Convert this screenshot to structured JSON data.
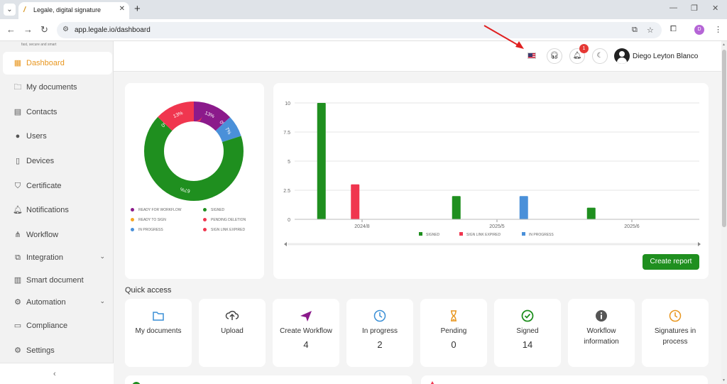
{
  "browser": {
    "tab_title": "Legale, digital signature",
    "url": "app.legale.io/dashboard",
    "profile_initial": "D"
  },
  "sidebar": {
    "logo_tagline": "fast, secure and smart",
    "items": [
      {
        "label": "Dashboard",
        "icon": "grid-icon",
        "active": true
      },
      {
        "label": "My documents",
        "icon": "folder-icon"
      },
      {
        "label": "Contacts",
        "icon": "contacts-icon"
      },
      {
        "label": "Users",
        "icon": "user-icon"
      },
      {
        "label": "Devices",
        "icon": "device-icon"
      },
      {
        "label": "Certificate",
        "icon": "shield-icon"
      },
      {
        "label": "Notifications",
        "icon": "bell-icon"
      },
      {
        "label": "Workflow",
        "icon": "workflow-icon"
      },
      {
        "label": "Integration",
        "icon": "integration-icon",
        "expandable": true
      },
      {
        "label": "Smart document",
        "icon": "smart-document-icon"
      },
      {
        "label": "Automation",
        "icon": "automation-icon",
        "expandable": true
      },
      {
        "label": "Compliance",
        "icon": "compliance-icon"
      },
      {
        "label": "Settings",
        "icon": "gear-icon"
      }
    ]
  },
  "header": {
    "notification_count": "1",
    "user_name": "Diego Leyton Blanco"
  },
  "donut": {
    "legend": [
      {
        "label": "READY FOR WORKFLOW",
        "color": "#8b1a8b"
      },
      {
        "label": "SIGNED",
        "color": "#1f8f1f"
      },
      {
        "label": "READY TO SIGN",
        "color": "#f5a623"
      },
      {
        "label": "PENDING DELETION",
        "color": "#f0364f"
      },
      {
        "label": "IN PROGRESS",
        "color": "#4a90d9"
      },
      {
        "label": "SIGN LINK EXPIRED",
        "color": "#f0364f"
      }
    ]
  },
  "chart_data": [
    {
      "type": "pie",
      "variant": "donut",
      "slices": [
        {
          "label": "READY FOR WORKFLOW",
          "value": 13,
          "display": "13%",
          "color": "#8b1a8b"
        },
        {
          "label": "READY TO SIGN",
          "value": 0,
          "display": "0%",
          "color": "#f5a623"
        },
        {
          "label": "IN PROGRESS",
          "value": 7,
          "display": "7%",
          "color": "#4a90d9"
        },
        {
          "label": "SIGNED",
          "value": 67,
          "display": "67%",
          "color": "#1f8f1f"
        },
        {
          "label": "PENDING DELETION",
          "value": 0,
          "display": "0%",
          "color": "#f0364f"
        },
        {
          "label": "SIGN LINK EXPIRED",
          "value": 13,
          "display": "13%",
          "color": "#f0364f"
        }
      ]
    },
    {
      "type": "bar",
      "categories": [
        "2024/8",
        "2025/5",
        "2025/6"
      ],
      "series": [
        {
          "name": "SIGNED",
          "color": "#1f8f1f",
          "values": [
            10,
            2,
            1
          ]
        },
        {
          "name": "SIGN LINK EXPIRED",
          "color": "#f0364f",
          "values": [
            3,
            0,
            0
          ]
        },
        {
          "name": "IN PROGRESS",
          "color": "#4a90d9",
          "values": [
            0,
            2,
            0
          ]
        }
      ],
      "yticks": [
        "10",
        "7.5",
        "5",
        "2.5",
        "0"
      ],
      "ylim": [
        0,
        10
      ],
      "grid": true,
      "legend": "bottom"
    }
  ],
  "bar_legend": [
    "SIGNED",
    "SIGN LINK EXPIRED",
    "IN PROGRESS"
  ],
  "buttons": {
    "create_report": "Create report"
  },
  "quick_access": {
    "title": "Quick access",
    "items": [
      {
        "label": "My documents",
        "count": null,
        "icon": "folder-icon",
        "color": "#3a8fd6"
      },
      {
        "label": "Upload",
        "count": null,
        "icon": "upload-icon",
        "color": "#444444"
      },
      {
        "label": "Create Workflow",
        "count": "4",
        "icon": "paper-plane-icon",
        "color": "#8b1a8b"
      },
      {
        "label": "In progress",
        "count": "2",
        "icon": "clock-icon",
        "color": "#3a8fd6"
      },
      {
        "label": "Pending",
        "count": "0",
        "icon": "hourglass-icon",
        "color": "#e8961e"
      },
      {
        "label": "Signed",
        "count": "14",
        "icon": "check-circle-icon",
        "color": "#1f8f1f"
      },
      {
        "label": "Workflow information",
        "count": null,
        "icon": "info-icon",
        "color": "#555555"
      },
      {
        "label": "Signatures in process",
        "count": null,
        "icon": "clock-icon",
        "color": "#e8961e"
      }
    ]
  }
}
